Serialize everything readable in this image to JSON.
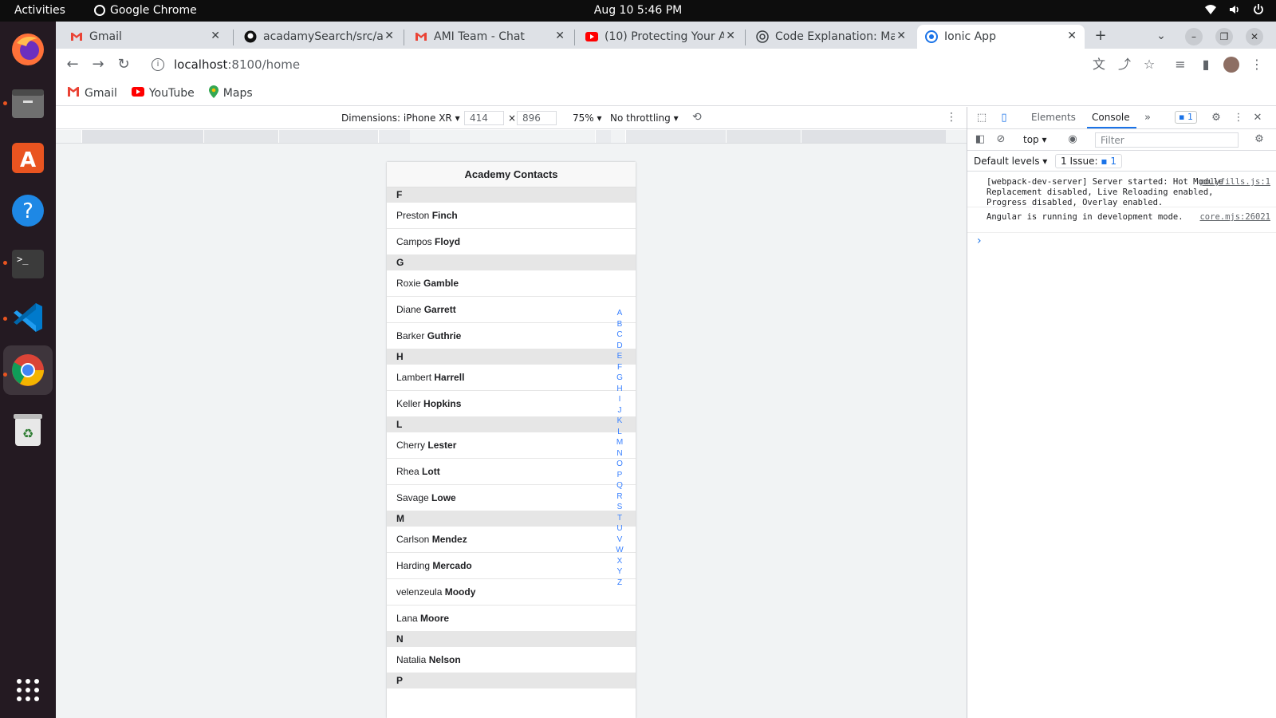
{
  "topbar": {
    "activities": "Activities",
    "app_name": "Google Chrome",
    "clock": "Aug 10  5:46 PM"
  },
  "tabs": [
    {
      "title": "Gmail",
      "icon": "gmail-icon"
    },
    {
      "title": "acadamySearch/src/a",
      "icon": "github-icon"
    },
    {
      "title": "AMI Team - Chat",
      "icon": "gmail-icon"
    },
    {
      "title": "(10) Protecting Your A",
      "icon": "youtube-icon"
    },
    {
      "title": "Code Explanation: Ma",
      "icon": "chatgpt-icon"
    },
    {
      "title": "Ionic App",
      "icon": "chrome-icon"
    }
  ],
  "address": {
    "host": "localhost",
    "rest": ":8100/home"
  },
  "bookmarks": [
    {
      "label": "Gmail",
      "icon": "gmail-icon"
    },
    {
      "label": "YouTube",
      "icon": "youtube-icon"
    },
    {
      "label": "Maps",
      "icon": "maps-icon"
    }
  ],
  "device_toolbar": {
    "dimensions": "Dimensions: iPhone XR",
    "width": "414",
    "height": "896",
    "times": "×",
    "zoom": "75%",
    "throttling": "No throttling"
  },
  "app": {
    "title": "Academy Contacts",
    "groups": [
      {
        "letter": "F",
        "contacts": [
          {
            "first": "Preston",
            "last": "Finch"
          },
          {
            "first": "Campos",
            "last": "Floyd"
          }
        ]
      },
      {
        "letter": "G",
        "contacts": [
          {
            "first": "Roxie",
            "last": "Gamble"
          },
          {
            "first": "Diane",
            "last": "Garrett"
          },
          {
            "first": "Barker",
            "last": "Guthrie"
          }
        ]
      },
      {
        "letter": "H",
        "contacts": [
          {
            "first": "Lambert",
            "last": "Harrell"
          },
          {
            "first": "Keller",
            "last": "Hopkins"
          }
        ]
      },
      {
        "letter": "L",
        "contacts": [
          {
            "first": "Cherry",
            "last": "Lester"
          },
          {
            "first": "Rhea",
            "last": "Lott"
          },
          {
            "first": "Savage",
            "last": "Lowe"
          }
        ]
      },
      {
        "letter": "M",
        "contacts": [
          {
            "first": "Carlson",
            "last": "Mendez"
          },
          {
            "first": "Harding",
            "last": "Mercado"
          },
          {
            "first": "velenzeula",
            "last": "Moody"
          },
          {
            "first": "Lana",
            "last": "Moore"
          }
        ]
      },
      {
        "letter": "N",
        "contacts": [
          {
            "first": "Natalia",
            "last": "Nelson"
          }
        ]
      },
      {
        "letter": "P",
        "contacts": []
      }
    ],
    "index": [
      "A",
      "B",
      "C",
      "D",
      "E",
      "F",
      "G",
      "H",
      "I",
      "J",
      "K",
      "L",
      "M",
      "N",
      "O",
      "P",
      "Q",
      "R",
      "S",
      "T",
      "U",
      "V",
      "W",
      "X",
      "Y",
      "Z"
    ]
  },
  "devtools": {
    "tab_elements": "Elements",
    "tab_console": "Console",
    "badge_count": "1",
    "context": "top",
    "filter_placeholder": "Filter",
    "default_levels": "Default levels",
    "issues_label": "1 Issue:",
    "issues_count": "1",
    "logs": [
      {
        "text": "[webpack-dev-server] Server started: Hot Module Replacement disabled, Live Reloading enabled, Progress disabled, Overlay enabled.",
        "source": "polyfills.js:1"
      },
      {
        "text": "Angular is running in development mode.",
        "source": "core.mjs:26021"
      }
    ],
    "prompt": "›"
  },
  "colors": {
    "accent": "#1a73e8",
    "ionic_primary": "#3880ff",
    "dock_bg": "#241a22"
  }
}
